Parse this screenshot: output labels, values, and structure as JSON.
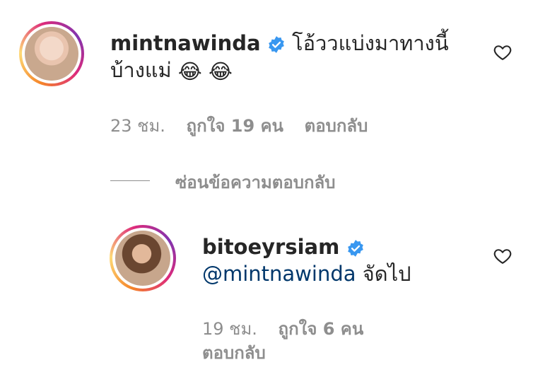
{
  "comment1": {
    "username": "mintnawinda",
    "text": "โอ้ววแบ่งมาทางนี้บ้างแม่",
    "emojis": [
      "😂",
      "😂"
    ],
    "time": "23 ชม.",
    "likes": "ถูกใจ 19 คน",
    "reply": "ตอบกลับ"
  },
  "hide_replies": "ซ่อนข้อความตอบกลับ",
  "comment2": {
    "username": "bitoeyrsiam",
    "mention": "@mintnawinda",
    "text": "จัดไป",
    "time": "19 ชม.",
    "likes": "ถูกใจ 6 คน",
    "reply": "ตอบกลับ"
  },
  "colors": {
    "verified": "#3897f0",
    "mention": "#00376b",
    "meta": "#8e8e8e"
  }
}
